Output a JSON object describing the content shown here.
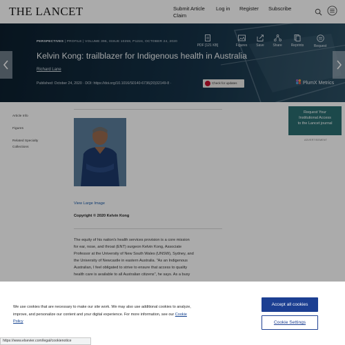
{
  "header": {
    "logo": "THE LANCET",
    "nav": [
      {
        "label": "Submit Article"
      },
      {
        "label": "Log in"
      },
      {
        "label": "Register"
      },
      {
        "label": "Subscribe"
      }
    ],
    "nav_second_line": "Claim",
    "icons": [
      "search-icon",
      "menu-icon"
    ]
  },
  "article": {
    "kicker_type": "PERSPECTIVES",
    "kicker_sub": "| PROFILE |",
    "kicker_meta": "VOLUME 396, ISSUE 10259, P1224, OCTOBER 24, 2020",
    "title": "Kelvin Kong: trailblazer for Indigenous health in Australia",
    "author": "Richard Lane",
    "published": "Published: October 24, 2020 ·",
    "doi_label": "DOI:",
    "doi": "https://doi.org/10.1016/S0140-6736(20)32149-8",
    "doi_suffix": "·",
    "check_updates": "Check for updates",
    "plumx": "PlumX Metrics"
  },
  "tools": [
    {
      "icon": "pdf-icon",
      "label": "PDF [121 KB]"
    },
    {
      "icon": "figures-icon",
      "label": "Figures"
    },
    {
      "icon": "save-icon",
      "label": "Save"
    },
    {
      "icon": "share-icon",
      "label": "Share"
    },
    {
      "icon": "reprints-icon",
      "label": "Reprints"
    },
    {
      "icon": "request-icon",
      "label": "Request"
    }
  ],
  "left_nav": [
    "Article Info",
    "Figures",
    "Related Specialty",
    "Collections"
  ],
  "access_box": {
    "line1": "Request Your",
    "line2": "Institutional Access",
    "line3": "to the Lancet journal"
  },
  "advertisement": "ADVERTISEMENT",
  "main": {
    "view_large": "View Large Image",
    "copyright": "Copyright © 2020 Kelvin Kong",
    "body_lines": [
      "The equity of his nation's health services provision is a core mission",
      "for ear, nose, and throat (ENT) surgeon Kelvin Kong, Associate",
      "Professor at the University of New South Wales (UNSW), Sydney, and",
      "the University of Newcastle in eastern Australia. \"As an Indigenous",
      "Australian, I feel obligated to strive to ensure that access to quality",
      "health care is available to all Australian citizens\", he says. As a busy"
    ]
  },
  "cookie": {
    "line1": "We use cookies that are necessary to make our site work. We may also use additional cookies to analyze,",
    "line2": "improve, and personalize our content and your digital experience. For more information, see our",
    "policy_link_a": "Cookie",
    "policy_link_b": "Policy",
    "accept": "Accept all cookies",
    "settings": "Cookie Settings"
  },
  "status_url": "https://www.elsevier.com/legal/cookienotice",
  "colors": {
    "accent": "#2b6e71",
    "cookie_button": "#1c3f92",
    "hero_bg": "#153247",
    "link": "#1a5aa8"
  }
}
